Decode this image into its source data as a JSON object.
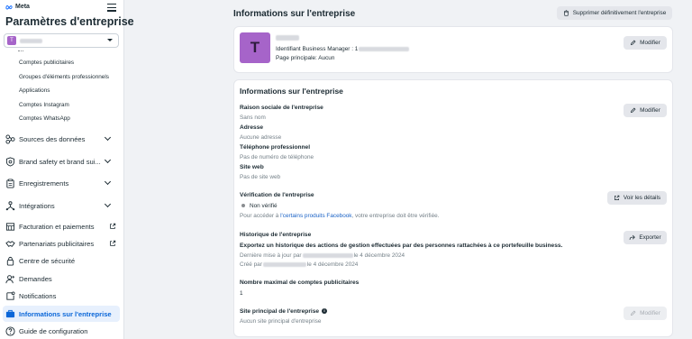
{
  "brand": {
    "name": "Meta"
  },
  "sidebar": {
    "title": "Paramètres d'entreprise",
    "account_avatar": "T",
    "subitems": [
      {
        "label": "Comptes publicitaires"
      },
      {
        "label": "Groupes d'éléments professionnels"
      },
      {
        "label": "Applications"
      },
      {
        "label": "Comptes Instagram"
      },
      {
        "label": "Comptes WhatsApp"
      }
    ],
    "nav": [
      {
        "label": "Sources des données",
        "icon": "data-sources-icon"
      },
      {
        "label": "Brand safety et brand sui...",
        "icon": "shield-icon"
      },
      {
        "label": "Enregistrements",
        "icon": "clipboard-icon"
      },
      {
        "label": "Intégrations",
        "icon": "integrations-icon"
      },
      {
        "label": "Facturation et paiements",
        "icon": "billing-icon"
      },
      {
        "label": "Partenariats publicitaires",
        "icon": "partnership-icon"
      },
      {
        "label": "Centre de sécurité",
        "icon": "lock-icon"
      },
      {
        "label": "Demandes",
        "icon": "person-add-icon"
      },
      {
        "label": "Notifications",
        "icon": "notification-icon"
      },
      {
        "label": "Informations sur l'entreprise",
        "icon": "business-info-icon"
      },
      {
        "label": "Guide de configuration",
        "icon": "help-icon"
      }
    ]
  },
  "header": {
    "title": "Informations sur l'entreprise",
    "delete_label": "Supprimer définitivement l'entreprise"
  },
  "summary": {
    "avatar": "T",
    "manager_id_label": "Identifiant Business Manager : 1",
    "main_page": "Page principale: Aucun",
    "edit_label": "Modifier"
  },
  "details": {
    "title": "Informations sur l'entreprise",
    "edit_label": "Modifier",
    "company_name_label": "Raison sociale de l'entreprise",
    "company_name_value": "Sans nom",
    "address_label": "Adresse",
    "address_value": "Aucune adresse",
    "phone_label": "Téléphone professionnel",
    "phone_value": "Pas de numéro de téléphone",
    "website_label": "Site web",
    "website_value": "Pas de site web",
    "verification_label": "Vérification de l'entreprise",
    "verification_status": "Non vérifié",
    "verification_text_before": "Pour accéder à ",
    "verification_link": "l'certains produits Facebook",
    "verification_text_after": ", votre entreprise doit être vérifiée.",
    "details_button": "Voir les détails",
    "history_label": "Historique de l'entreprise",
    "history_desc": "Exportez un historique des actions de gestion effectuées par des personnes rattachées à ce portefeuille business.",
    "updated_prefix": "Dernière mise à jour par",
    "updated_date": "le 4 décembre 2024",
    "created_prefix": "Créé par",
    "created_date": "le 4 décembre 2024",
    "export_label": "Exporter",
    "max_accounts_label": "Nombre maximal de comptes publicitaires",
    "max_accounts_value": "1",
    "main_site_label": "Site principal de l'entreprise",
    "main_site_info": "i",
    "main_site_value": "Aucun site principal d'entreprise",
    "main_site_edit": "Modifier"
  }
}
